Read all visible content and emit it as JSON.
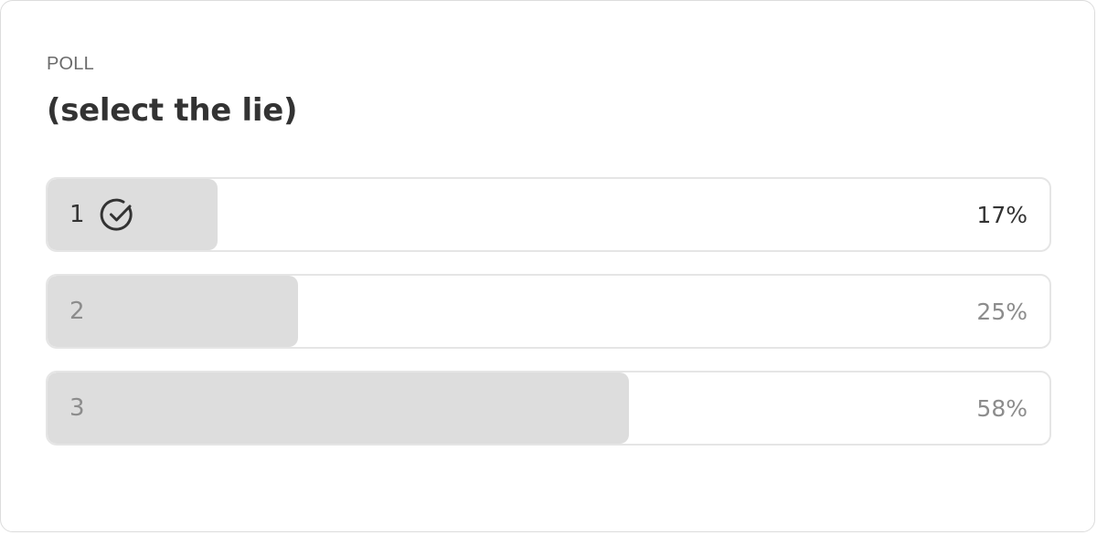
{
  "poll": {
    "label": "POLL",
    "title": "(select the lie)",
    "options": [
      {
        "label": "1",
        "percent_text": "17%",
        "percent": 17,
        "selected": true
      },
      {
        "label": "2",
        "percent_text": "25%",
        "percent": 25,
        "selected": false
      },
      {
        "label": "3",
        "percent_text": "58%",
        "percent": 58,
        "selected": false
      }
    ],
    "colors": {
      "fill": "#dddddd",
      "border": "#e5e5e5",
      "text_selected": "#333333",
      "text_muted": "#8c8c8c"
    },
    "icons": {
      "selected_marker": "check-circle-icon"
    }
  }
}
